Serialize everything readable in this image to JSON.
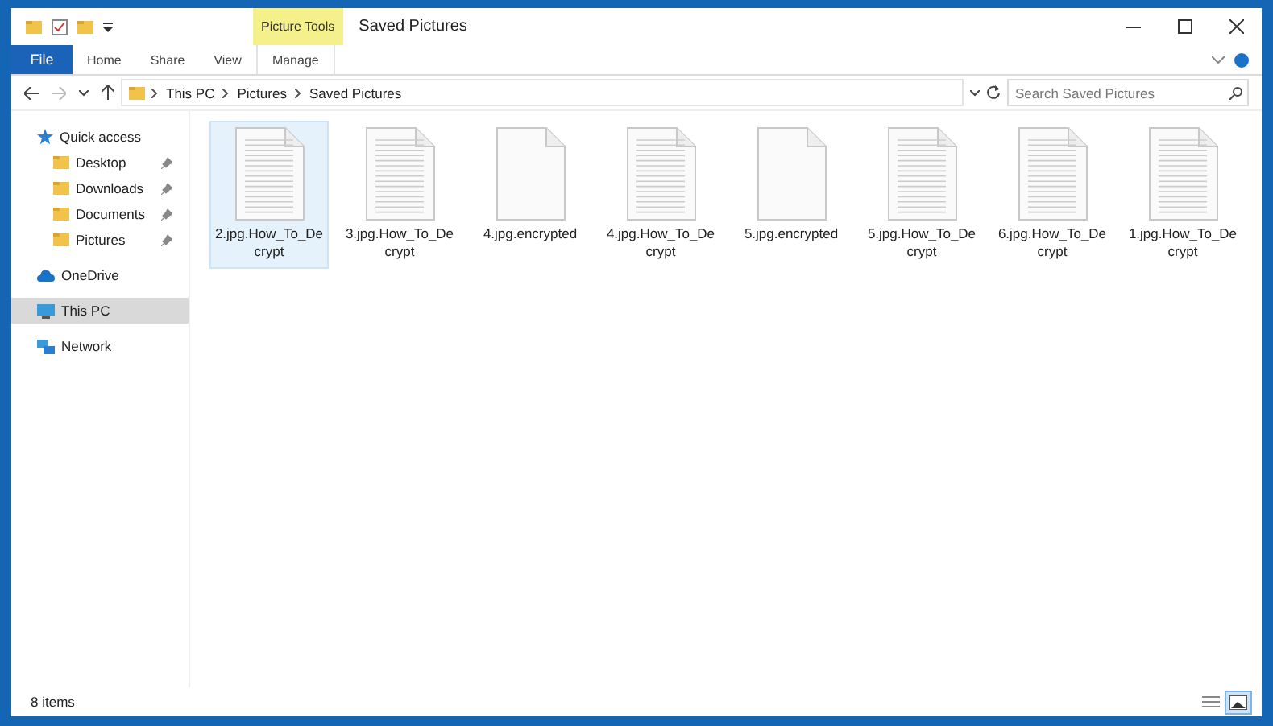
{
  "window": {
    "title": "Saved Pictures",
    "context_tab": "Picture Tools"
  },
  "ribbon_tabs": [
    {
      "label": "File",
      "kind": "file",
      "selected": false
    },
    {
      "label": "Home",
      "kind": "tab",
      "selected": false
    },
    {
      "label": "Share",
      "kind": "tab",
      "selected": false
    },
    {
      "label": "View",
      "kind": "tab",
      "selected": false
    },
    {
      "label": "Manage",
      "kind": "context",
      "selected": false
    }
  ],
  "address": {
    "path": [
      "This PC",
      "Pictures",
      "Saved Pictures"
    ]
  },
  "search": {
    "placeholder": "Search Saved Pictures"
  },
  "sidebar": {
    "items": [
      {
        "label": "Quick access",
        "kind": "star",
        "selected": false,
        "children": [
          {
            "label": "Desktop",
            "kind": "folder",
            "pinned": true,
            "selected": false
          },
          {
            "label": "Downloads",
            "kind": "folder",
            "pinned": true,
            "selected": false
          },
          {
            "label": "Documents",
            "kind": "folder",
            "pinned": true,
            "selected": false
          },
          {
            "label": "Pictures",
            "kind": "folder",
            "pinned": true,
            "selected": false
          }
        ]
      },
      {
        "label": "OneDrive",
        "kind": "cloud",
        "selected": false
      },
      {
        "label": "This PC",
        "kind": "pc",
        "selected": true
      },
      {
        "label": "Network",
        "kind": "network",
        "selected": false
      }
    ]
  },
  "files": [
    {
      "name": "2.jpg.How_To_Decrypt",
      "kind": "text",
      "selected": true
    },
    {
      "name": "3.jpg.How_To_Decrypt",
      "kind": "text",
      "selected": false
    },
    {
      "name": "4.jpg.encrypted",
      "kind": "blank",
      "selected": false
    },
    {
      "name": "4.jpg.How_To_Decrypt",
      "kind": "text",
      "selected": false
    },
    {
      "name": "5.jpg.encrypted",
      "kind": "blank",
      "selected": false
    },
    {
      "name": "5.jpg.How_To_Decrypt",
      "kind": "text",
      "selected": false
    },
    {
      "name": "6.jpg.How_To_Decrypt",
      "kind": "text",
      "selected": false
    },
    {
      "name": "1.jpg.How_To_Decrypt",
      "kind": "text",
      "selected": false
    }
  ],
  "status_bar": {
    "text": "8 items"
  }
}
